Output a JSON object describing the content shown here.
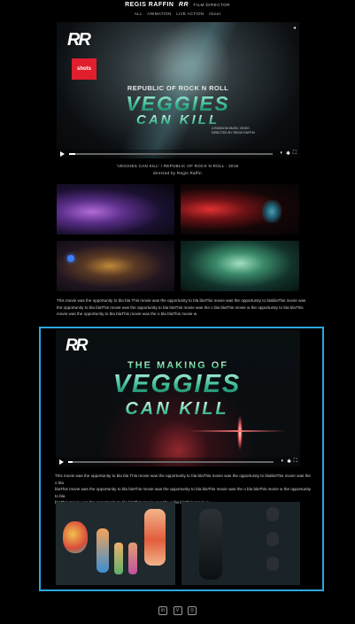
{
  "header": {
    "brand_name": "REGIS RAFFIN",
    "brand_logo": "RR",
    "role": "FILM DIRECTOR",
    "nav": [
      "ALL",
      "ANIMATION",
      "LIVE ACTION",
      "About"
    ]
  },
  "video1": {
    "logo": "RR",
    "badge": "shots",
    "band_title": "REPUBLIC OF ROCK N ROLL",
    "title_line1": "VEGGIES",
    "title_line2": "CAN KILL",
    "credits": [
      "A RANDOM MUSIC VIDEO",
      "DIRECTED BY REGIS RAFFIN"
    ],
    "progress": 0.03
  },
  "caption": {
    "line1": "'VEGGIES CAN KILL' / REPUBLIC OF ROCK N ROLL - 2016",
    "line2": "directed by Regis Raffin"
  },
  "description1": {
    "lines": [
      "This movie was the opportunity to bla bla This movie was the opportunity to bla blaThis movie was the opportunity to blablaThis movie was",
      "the opportunity to bla blaThis movie was the opportunity to bla blaThis movie was the o bla blaThis movie w the opportunity to bla blaThis",
      "movie was the opportunity to bla blaThis movie was the o bla blaThis movie w."
    ]
  },
  "making_of": {
    "logo": "RR",
    "heading": "THE MAKING OF",
    "title_line1": "VEGGIES",
    "title_line2": "CAN KILL",
    "progress": 0.02
  },
  "description2": {
    "lines": [
      "This movie was the opportunity to bla bla This movie was the opportunity to bla blaThis movie was the opportunity to blablaThis movie was the o bla",
      "blaThis movie was the opportunity to bla blaThis movie was the opportunity to bla blaThis movie was the o bla blaThis movie w the opportunity to bla",
      "blaThis movie was the opportunity to bla blaThis movie was the o bla blaThis movie w."
    ]
  },
  "footer": {
    "social_icons": [
      "linkedin-icon",
      "vimeo-icon",
      "instagram-icon"
    ],
    "glyphs": [
      "in",
      "V",
      "◎"
    ]
  },
  "colors": {
    "background": "#000000",
    "box_border": "#2aa7df",
    "title_green": "#35b890",
    "badge_red": "#e01e2d"
  }
}
